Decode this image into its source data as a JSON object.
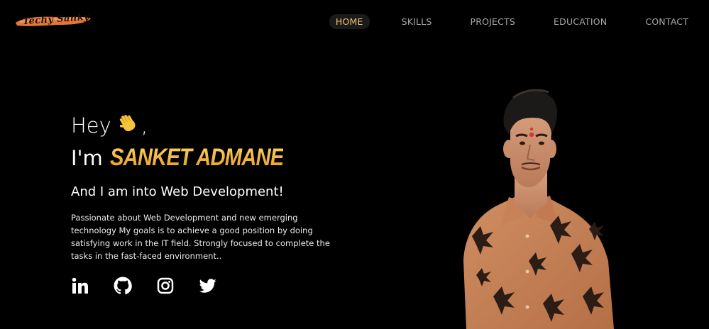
{
  "header": {
    "logo_text": "Techy Sanky",
    "nav": [
      {
        "label": "HOME",
        "active": true
      },
      {
        "label": "SKILLS",
        "active": false
      },
      {
        "label": "PROJECTS",
        "active": false
      },
      {
        "label": "EDUCATION",
        "active": false
      },
      {
        "label": "CONTACT",
        "active": false
      }
    ]
  },
  "hero": {
    "greeting": "Hey",
    "greeting_icon": "waving-hand-icon",
    "greeting_suffix": ",",
    "intro_prefix": "I'm",
    "name": "SANKET ADMANE",
    "subtitle": "And I am into Web Development!",
    "description": "Passionate about Web Development and new emerging technology My goals is to achieve a good position by doing satisfying work in the IT field. Strongly focused to complete the tasks in the fast-faced environment..",
    "socials": [
      {
        "name": "linkedin-icon"
      },
      {
        "name": "github-icon"
      },
      {
        "name": "instagram-icon"
      },
      {
        "name": "twitter-icon"
      }
    ]
  },
  "colors": {
    "background": "#000000",
    "accent": "#f2c27a",
    "name_gold": "#f6b843",
    "text": "#ffffff",
    "nav_text": "#a7a7a7",
    "shirt": "#c8835a"
  }
}
